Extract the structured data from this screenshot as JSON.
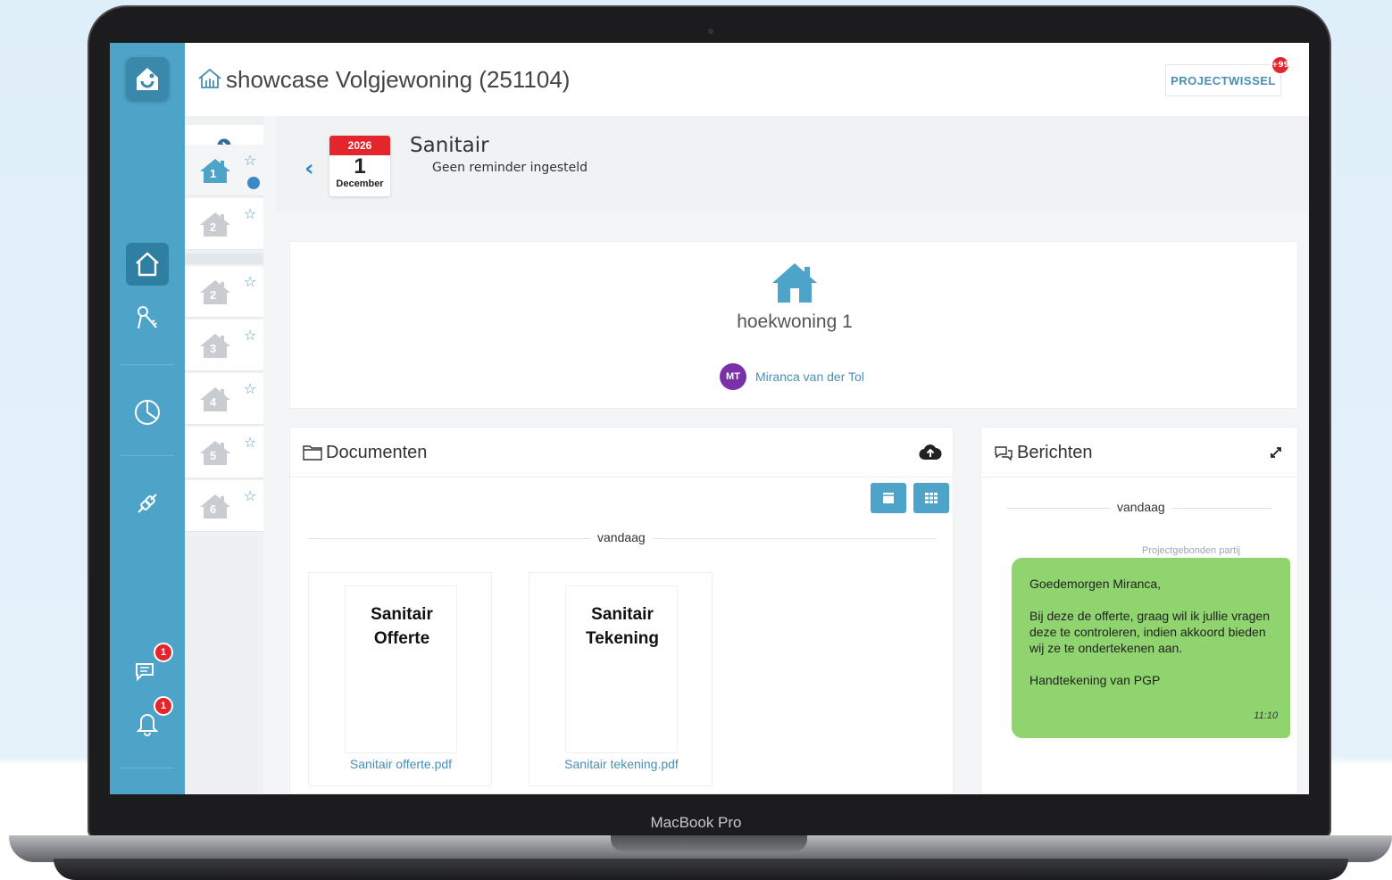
{
  "device": {
    "label": "MacBook Pro"
  },
  "app": {
    "title": "showcase Volgjewoning (251104)",
    "project_switch_label": "PROJECTWISSEL",
    "project_switch_badge": "+99"
  },
  "rail": {
    "items": [
      {
        "icon": "home-icon",
        "active": true
      },
      {
        "icon": "keys-icon",
        "active": false
      },
      {
        "icon": "pie-chart-icon",
        "active": false
      },
      {
        "icon": "plug-icon",
        "active": false
      }
    ],
    "chat_badge": "1",
    "bell_badge": "1"
  },
  "units": [
    {
      "num": "1",
      "starred": false,
      "selected": true
    },
    {
      "num": "2",
      "starred": false,
      "selected": false
    },
    {
      "num": "2",
      "starred": false,
      "selected": false
    },
    {
      "num": "3",
      "starred": false,
      "selected": false
    },
    {
      "num": "4",
      "starred": false,
      "selected": false
    },
    {
      "num": "5",
      "starred": false,
      "selected": false
    },
    {
      "num": "6",
      "starred": false,
      "selected": false
    }
  ],
  "reminder": {
    "year": "2026",
    "day": "1",
    "month": "December",
    "title": "Sanitair",
    "subtitle": "Geen reminder ingesteld"
  },
  "house": {
    "name": "hoekwoning 1",
    "owner_initials": "MT",
    "owner_name": "Miranca van der Tol"
  },
  "documents": {
    "title": "Documenten",
    "date_divider": "vandaag",
    "files": [
      {
        "preview_line1": "Sanitair",
        "preview_line2": "Offerte",
        "filename": "Sanitair offerte.pdf"
      },
      {
        "preview_line1": "Sanitair",
        "preview_line2": "Tekening",
        "filename": "Sanitair tekening.pdf"
      }
    ]
  },
  "messages": {
    "title": "Berichten",
    "date_divider": "vandaag",
    "party": "Projectgebonden partij",
    "message": {
      "greeting": "Goedemorgen Miranca,",
      "body": "Bij deze de offerte, graag wil ik jullie vragen deze te controleren, indien akkoord bieden wij ze te ondertekenen aan.",
      "signature": "Handtekening van PGP",
      "time": "11:10"
    }
  },
  "colors": {
    "brand": "#4ea3c8",
    "accent_red": "#e3262b",
    "bubble_green": "#8fd46e",
    "avatar_purple": "#7b2fa8"
  }
}
